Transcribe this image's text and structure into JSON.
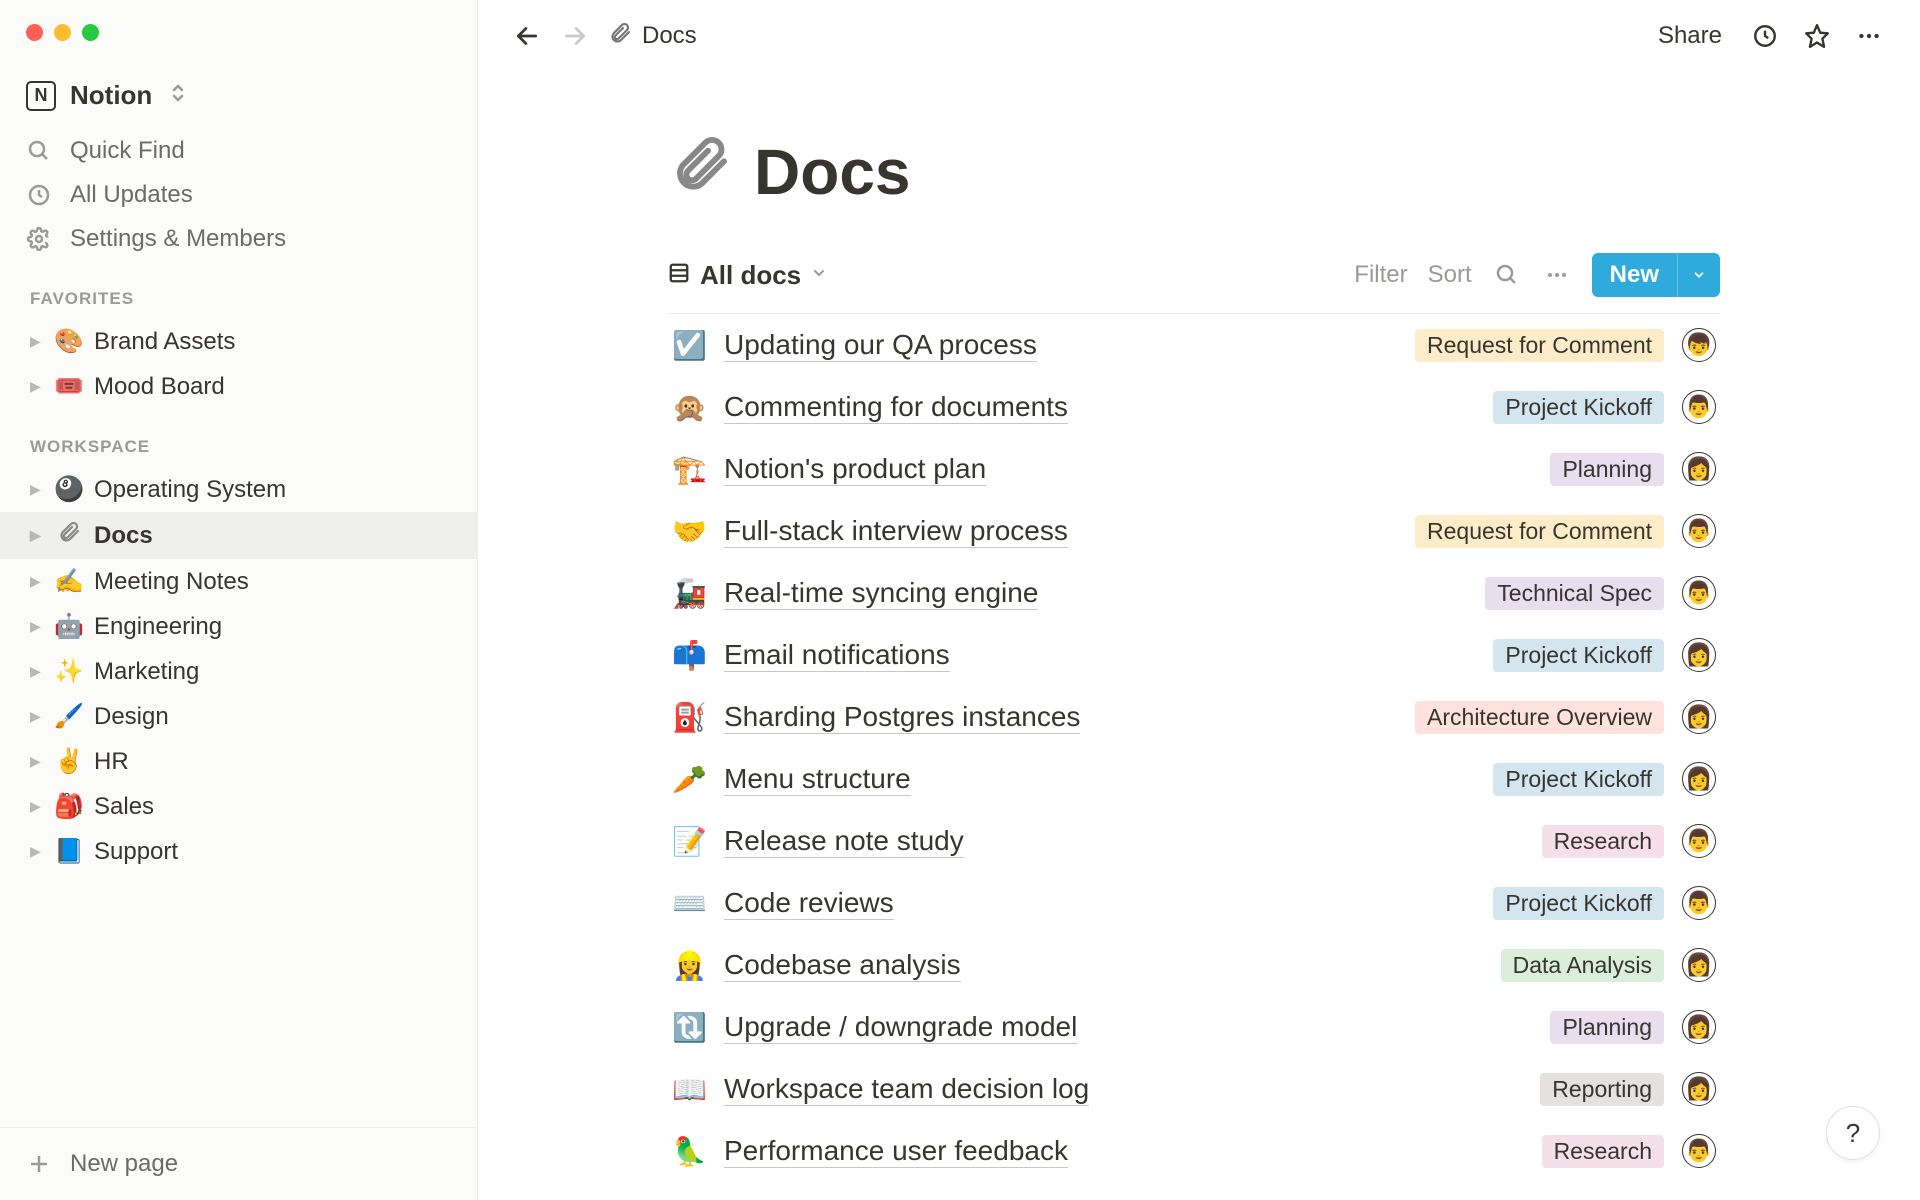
{
  "workspace": {
    "name": "Notion"
  },
  "sidebar": {
    "quick_find": "Quick Find",
    "all_updates": "All Updates",
    "settings": "Settings & Members",
    "favorites_label": "FAVORITES",
    "favorites": [
      {
        "emoji": "🎨",
        "label": "Brand Assets"
      },
      {
        "emoji": "🎟️",
        "label": "Mood Board"
      }
    ],
    "workspace_label": "WORKSPACE",
    "workspace_pages": [
      {
        "emoji": "🎱",
        "label": "Operating System",
        "active": false
      },
      {
        "emoji": "📎",
        "label": "Docs",
        "active": true
      },
      {
        "emoji": "✍️",
        "label": "Meeting Notes",
        "active": false
      },
      {
        "emoji": "🤖",
        "label": "Engineering",
        "active": false
      },
      {
        "emoji": "✨",
        "label": "Marketing",
        "active": false
      },
      {
        "emoji": "🖌️",
        "label": "Design",
        "active": false
      },
      {
        "emoji": "✌️",
        "label": "HR",
        "active": false
      },
      {
        "emoji": "🎒",
        "label": "Sales",
        "active": false
      },
      {
        "emoji": "📘",
        "label": "Support",
        "active": false
      }
    ],
    "new_page": "New page"
  },
  "topbar": {
    "breadcrumb_title": "Docs",
    "share": "Share"
  },
  "page": {
    "title": "Docs"
  },
  "view_toolbar": {
    "view_name": "All docs",
    "filter": "Filter",
    "sort": "Sort",
    "new": "New"
  },
  "tag_colors": {
    "Request for Comment": "#fdecc8",
    "Project Kickoff": "#d3e5ef",
    "Planning": "#e8deee",
    "Technical Spec": "#e8deee",
    "Architecture Overview": "#ffe2dd",
    "Research": "#f5e0e9",
    "Data Analysis": "#dbeddb",
    "Reporting": "#e3e2e0"
  },
  "docs": [
    {
      "emoji": "☑️",
      "title": "Updating our QA process",
      "tag": "Request for Comment",
      "avatar": "👦"
    },
    {
      "emoji": "🙊",
      "title": "Commenting for documents",
      "tag": "Project Kickoff",
      "avatar": "👨"
    },
    {
      "emoji": "🏗️",
      "title": "Notion's product plan",
      "tag": "Planning",
      "avatar": "👩"
    },
    {
      "emoji": "🤝",
      "title": "Full-stack interview process",
      "tag": "Request for Comment",
      "avatar": "👨"
    },
    {
      "emoji": "🚂",
      "title": "Real-time syncing engine",
      "tag": "Technical Spec",
      "avatar": "👨"
    },
    {
      "emoji": "📫",
      "title": "Email notifications",
      "tag": "Project Kickoff",
      "avatar": "👩"
    },
    {
      "emoji": "⛽",
      "title": "Sharding Postgres instances",
      "tag": "Architecture Overview",
      "avatar": "👩"
    },
    {
      "emoji": "🥕",
      "title": "Menu structure",
      "tag": "Project Kickoff",
      "avatar": "👩"
    },
    {
      "emoji": "📝",
      "title": "Release note study",
      "tag": "Research",
      "avatar": "👨"
    },
    {
      "emoji": "⌨️",
      "title": "Code reviews",
      "tag": "Project Kickoff",
      "avatar": "👨"
    },
    {
      "emoji": "👷‍♀️",
      "title": "Codebase analysis",
      "tag": "Data Analysis",
      "avatar": "👩"
    },
    {
      "emoji": "🔃",
      "title": "Upgrade / downgrade model",
      "tag": "Planning",
      "avatar": "👩"
    },
    {
      "emoji": "📖",
      "title": "Workspace team decision log",
      "tag": "Reporting",
      "avatar": "👩"
    },
    {
      "emoji": "🦜",
      "title": "Performance user feedback",
      "tag": "Research",
      "avatar": "👨"
    }
  ]
}
